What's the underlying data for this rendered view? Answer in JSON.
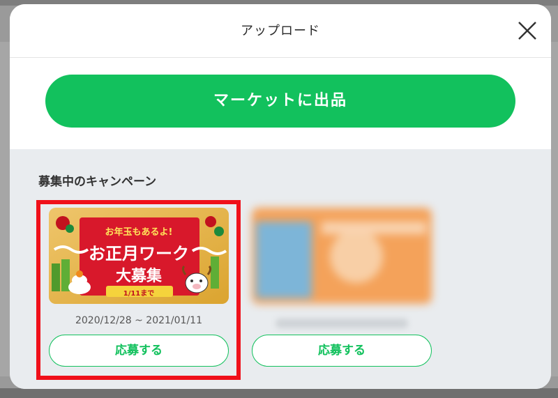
{
  "modal": {
    "title": "アップロード"
  },
  "upload": {
    "market_button_label": "マーケットに出品"
  },
  "campaigns": {
    "section_title": "募集中のキャンペーン",
    "items": [
      {
        "banner": {
          "top_text": "お年玉もあるよ!",
          "main_text": "お正月ワーク",
          "sub_text": "大募集",
          "deadline": "1/11まで"
        },
        "period": "2020/12/28 ~ 2021/01/11",
        "apply_label": "応募する"
      },
      {
        "period": "",
        "apply_label": "応募する"
      }
    ]
  },
  "colors": {
    "accent": "#12c15d",
    "highlight": "#f0101a",
    "banner_red": "#d8182b",
    "banner_gold": "#e9b23a"
  }
}
